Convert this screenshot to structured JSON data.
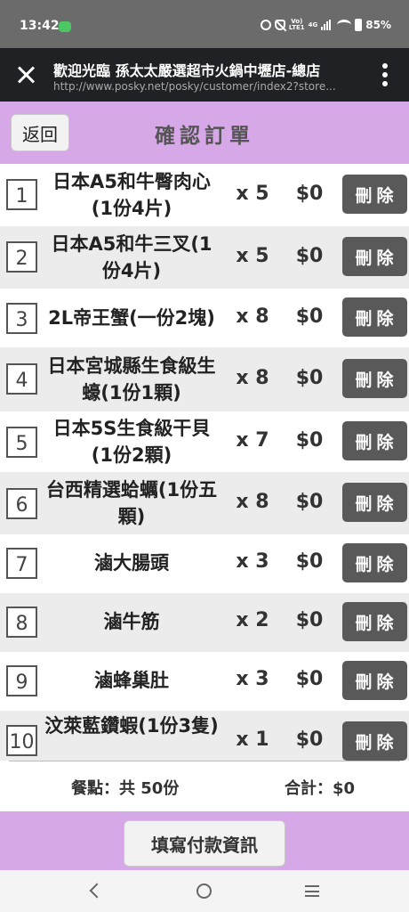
{
  "status_bar": {
    "time": "13:42",
    "network_label_top": "Vo)",
    "network_label_bottom": "LTE1",
    "network_type": "4G",
    "battery": "85%"
  },
  "app_bar": {
    "title": "歡迎光臨 孫太太嚴選超市火鍋中壢店-總店",
    "url": "http://www.posky.net/posky/customer/index2?store..."
  },
  "header": {
    "back_label": "返回",
    "title": "確認訂單"
  },
  "items": [
    {
      "index": "1",
      "name": "日本A5和牛臀肉心(1份4片)",
      "qty": "x 5",
      "price": "$0",
      "delete_label": "刪除"
    },
    {
      "index": "2",
      "name": "日本A5和牛三叉(1份4片)",
      "qty": "x 5",
      "price": "$0",
      "delete_label": "刪除"
    },
    {
      "index": "3",
      "name": "2L帝王蟹(一份2塊)",
      "qty": "x 8",
      "price": "$0",
      "delete_label": "刪除"
    },
    {
      "index": "4",
      "name": "日本宮城縣生食級生蠔(1份1顆)",
      "qty": "x 8",
      "price": "$0",
      "delete_label": "刪除"
    },
    {
      "index": "5",
      "name": "日本5S生食級干貝(1份2顆)",
      "qty": "x 7",
      "price": "$0",
      "delete_label": "刪除"
    },
    {
      "index": "6",
      "name": "台西精選蛤蠣(1份五顆)",
      "qty": "x 8",
      "price": "$0",
      "delete_label": "刪除"
    },
    {
      "index": "7",
      "name": "滷大腸頭",
      "qty": "x 3",
      "price": "$0",
      "delete_label": "刪除"
    },
    {
      "index": "8",
      "name": "滷牛筋",
      "qty": "x 2",
      "price": "$0",
      "delete_label": "刪除"
    },
    {
      "index": "9",
      "name": "滷蜂巢肚",
      "qty": "x 3",
      "price": "$0",
      "delete_label": "刪除"
    },
    {
      "index": "10",
      "name": "汶萊藍鑽蝦(1份3隻)",
      "qty": "x 1",
      "price": "$0",
      "delete_label": "刪除"
    }
  ],
  "summary": {
    "count_text": "餐點：共 50份",
    "total_text": "合計：$0"
  },
  "footer": {
    "payment_label": "填寫付款資訊"
  },
  "colors": {
    "accent": "#d7a8e8",
    "delete_button": "#595959",
    "row_alt": "#ececec"
  }
}
